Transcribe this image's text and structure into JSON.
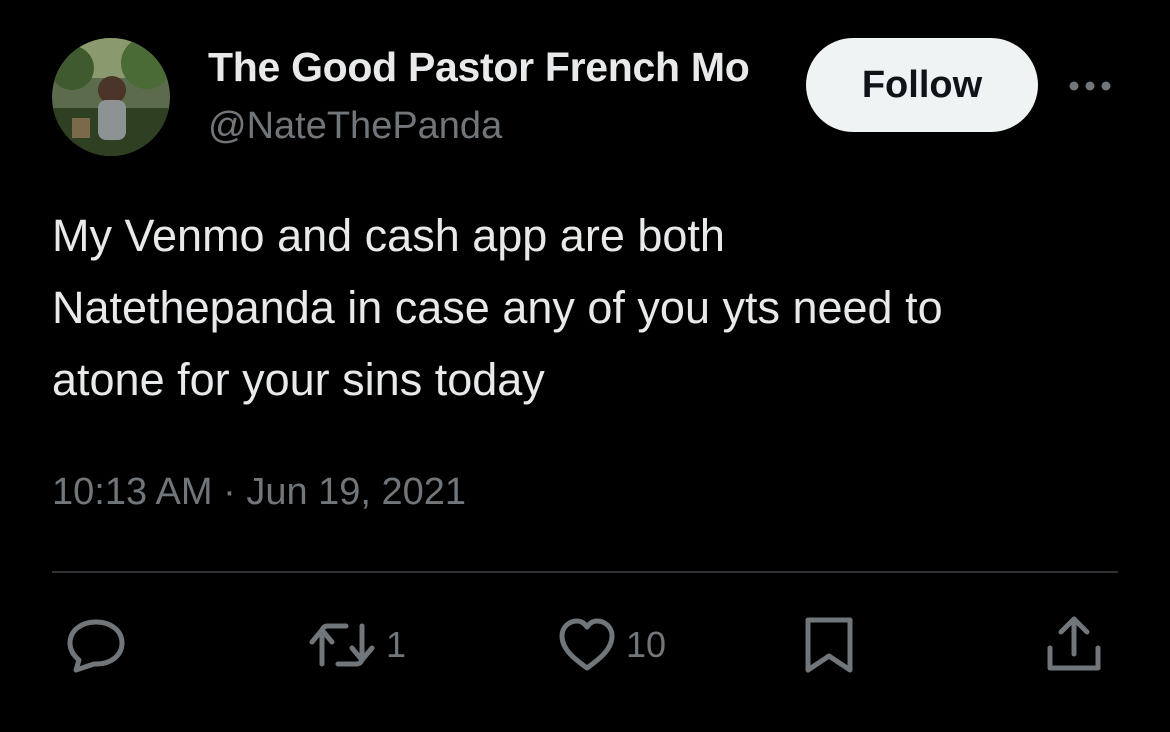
{
  "author": {
    "display_name": "The Good Pastor French Mo",
    "handle": "@NateThePanda"
  },
  "follow_button": {
    "label": "Follow"
  },
  "tweet": {
    "lines": [
      "My Venmo and cash app are both",
      "Natethepanda in case any of you yts need to",
      "atone for your sins today"
    ],
    "timestamp": "10:13 AM · Jun 19, 2021"
  },
  "actions": {
    "reply_icon": "reply-icon",
    "retweet_icon": "retweet-icon",
    "retweet_count": "1",
    "like_icon": "heart-icon",
    "like_count": "10",
    "bookmark_icon": "bookmark-icon",
    "share_icon": "share-icon"
  },
  "colors": {
    "background": "#000000",
    "primary_text": "#e7e9ea",
    "secondary_text": "#71767b",
    "divider": "#2f3336",
    "follow_button_bg": "#eff3f4",
    "follow_button_text": "#0f1419"
  }
}
